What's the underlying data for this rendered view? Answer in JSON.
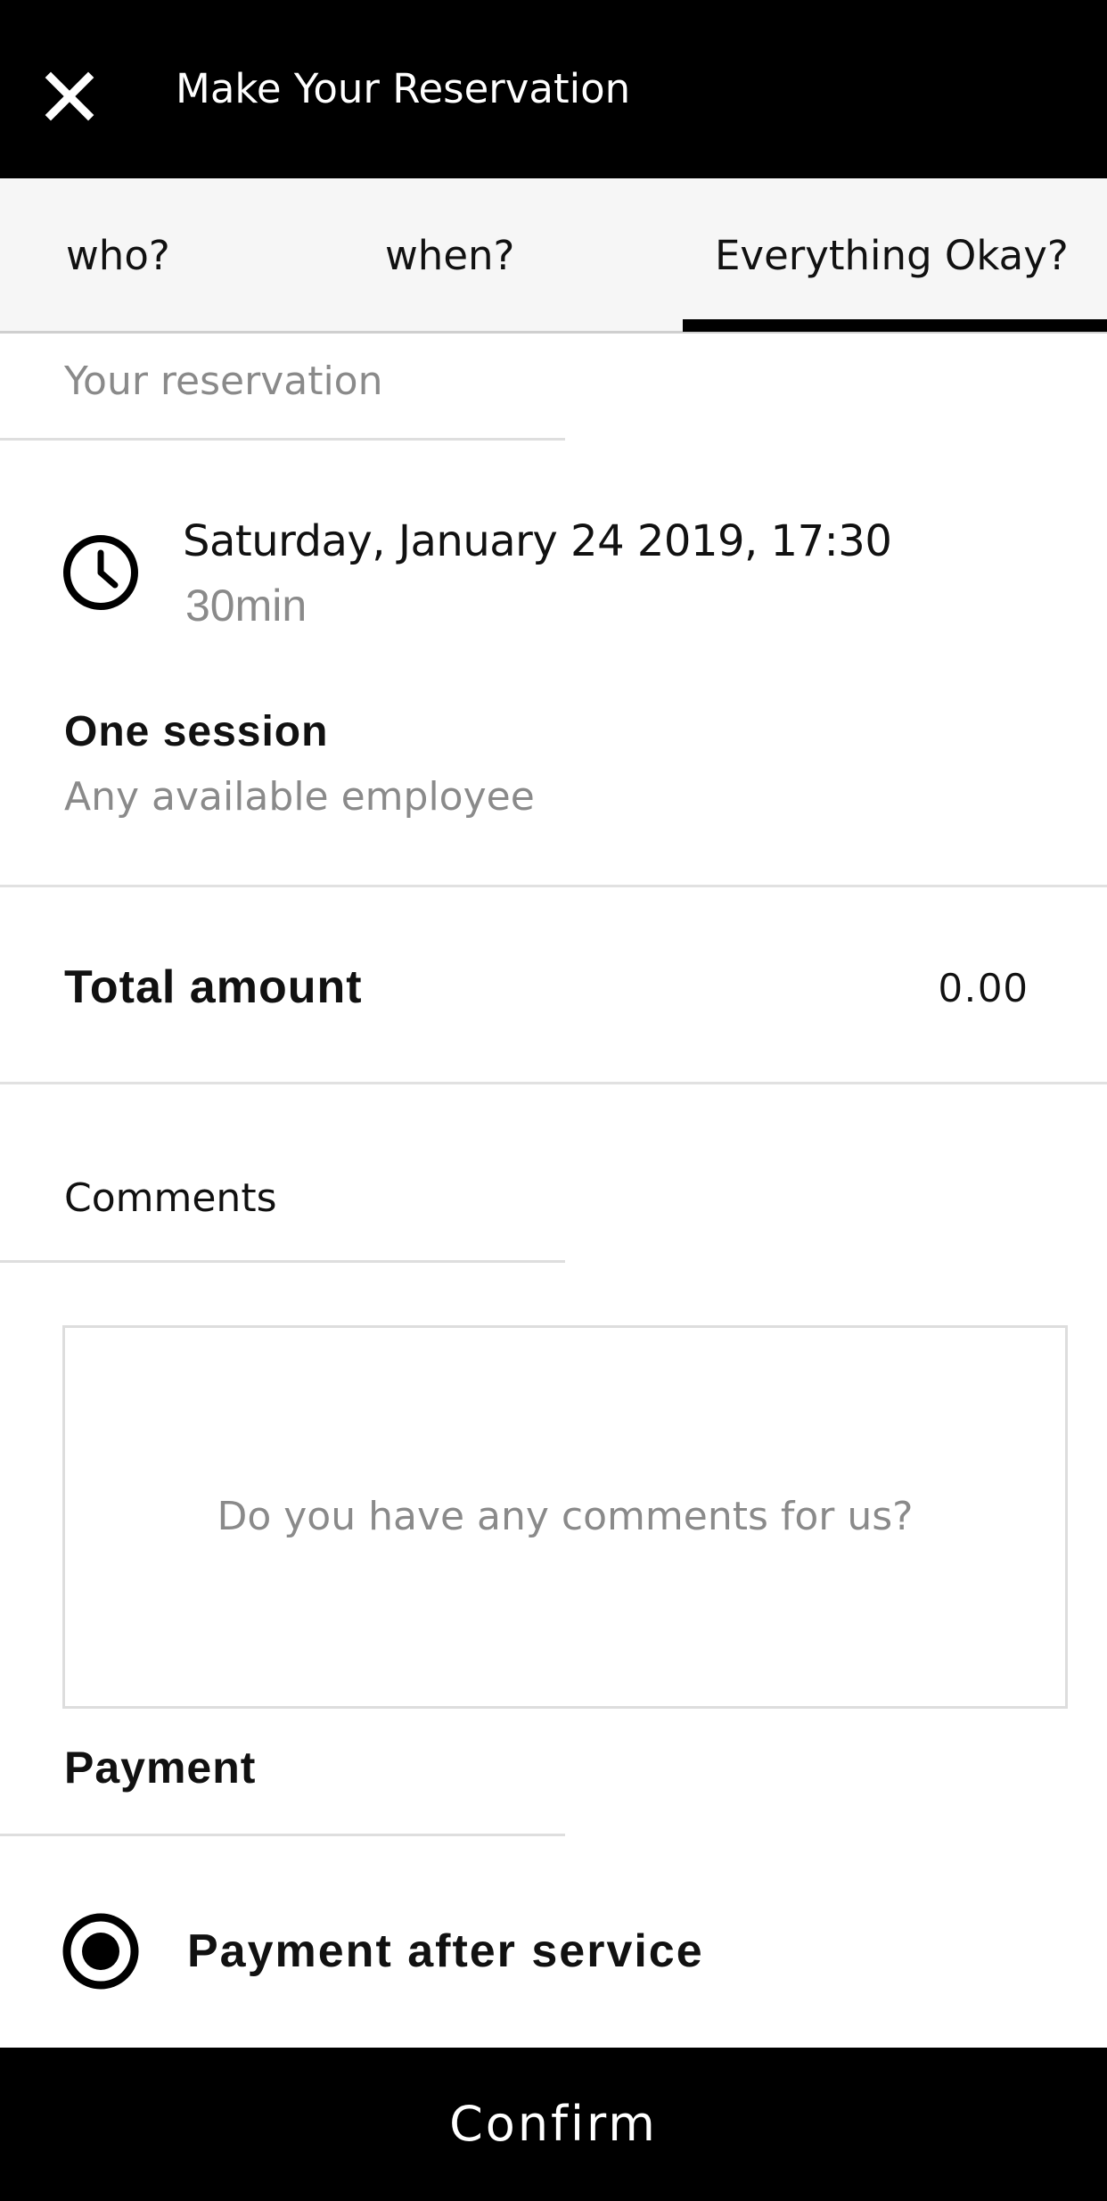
{
  "header": {
    "title": "Make Your Reservation",
    "close_icon": "close-icon"
  },
  "tabs": [
    {
      "label": "who?",
      "active": false
    },
    {
      "label": "when?",
      "active": false
    },
    {
      "label": "Everything Okay?",
      "active": true
    }
  ],
  "reservation": {
    "section_label": "Your reservation",
    "date_time": "Saturday, January 24 2019, 17:30",
    "duration": "30min",
    "service": "One session",
    "employee": "Any available employee",
    "clock_icon": "clock-icon"
  },
  "total": {
    "label": "Total amount",
    "value": "0.00"
  },
  "comments": {
    "label": "Comments",
    "placeholder": "Do you have any comments for us?",
    "value": ""
  },
  "payment": {
    "label": "Payment",
    "option_label": "Payment after service",
    "option_selected": true,
    "radio_icon": "radio-selected-icon"
  },
  "actions": {
    "confirm_label": "Confirm"
  },
  "colors": {
    "header_bg": "#000000",
    "tab_bar_bg": "#f6f6f6",
    "accent": "#000000",
    "muted_text": "#8a8a8a",
    "divider": "#e1e1e1"
  }
}
